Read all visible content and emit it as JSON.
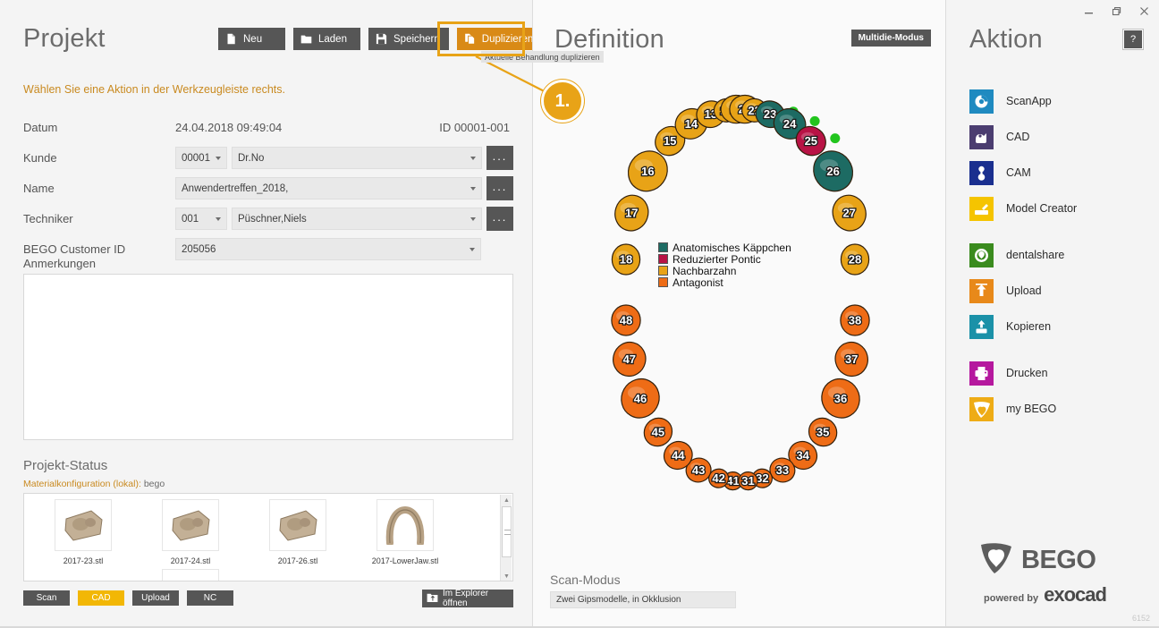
{
  "window": {
    "minimize_label": "minimize",
    "restore_label": "restore",
    "close_label": "close",
    "build_number": "6152"
  },
  "project_panel": {
    "title": "Projekt",
    "toolbar": [
      {
        "label": "Neu",
        "icon": "new-file-icon",
        "accent": false
      },
      {
        "label": "Laden",
        "icon": "folder-icon",
        "accent": false
      },
      {
        "label": "Speichern",
        "icon": "save-icon",
        "accent": false
      },
      {
        "label": "Duplizieren",
        "icon": "copy-icon",
        "accent": true
      }
    ],
    "tooltip": "Aktuelle Behandlung duplizieren",
    "callout_number": "1.",
    "hint": "Wählen Sie eine Aktion in der Werkzeugleiste rechts.",
    "fields": {
      "datum_label": "Datum",
      "datum_value": "24.04.2018  09:49:04",
      "id_value": "ID  00001-001",
      "kunde_label": "Kunde",
      "kunde_number": "00001",
      "kunde_name": "Dr.No",
      "name_label": "Name",
      "name_value": "Anwendertreffen_2018,",
      "techniker_label": "Techniker",
      "techniker_number": "001",
      "techniker_name": "Püschner,Niels",
      "customer_id_label": "BEGO Customer ID",
      "customer_id_value": "205056",
      "dots_label": "...",
      "anmerkungen_label": "Anmerkungen",
      "anmerkungen_value": ""
    },
    "status": {
      "title": "Projekt-Status",
      "material_label": "Materialkonfiguration (lokal):",
      "material_value": "bego",
      "files": [
        {
          "name": "2017-23.stl",
          "kind": "die"
        },
        {
          "name": "2017-24.stl",
          "kind": "die"
        },
        {
          "name": "2017-26.stl",
          "kind": "die"
        },
        {
          "name": "2017-LowerJaw.stl",
          "kind": "jaw"
        }
      ],
      "buttons": [
        {
          "label": "Scan",
          "active": false
        },
        {
          "label": "CAD",
          "active": true
        },
        {
          "label": "Upload",
          "active": false
        },
        {
          "label": "NC",
          "active": false
        }
      ],
      "explorer_button": "Im Explorer öffnen",
      "explorer_icon": "folder-up-icon"
    }
  },
  "definition_panel": {
    "title": "Definition",
    "multidie_button": "Multidie-Modus",
    "legend": [
      {
        "label": "Anatomisches Käppchen",
        "color": "#1d6b63"
      },
      {
        "label": "Reduzierter Pontic",
        "color": "#b81345"
      },
      {
        "label": "Nachbarzahn",
        "color": "#e8a317"
      },
      {
        "label": "Antagonist",
        "color": "#ee6c16"
      }
    ],
    "scan_modus_label": "Scan-Modus",
    "scan_modus_value": "Zwei Gipsmodelle, in Okklusion",
    "tooth_chart": {
      "colors": {
        "anatomic_cap": "#1d6b63",
        "reduced_pontic": "#b81345",
        "neighbor": "#e8a317",
        "antagonist": "#ee6c16",
        "marker": "#22c51e"
      },
      "upper_right": [
        {
          "id": "18",
          "type": "neighbor"
        },
        {
          "id": "17",
          "type": "neighbor"
        },
        {
          "id": "16",
          "type": "neighbor"
        },
        {
          "id": "15",
          "type": "neighbor"
        },
        {
          "id": "14",
          "type": "neighbor"
        },
        {
          "id": "13",
          "type": "neighbor"
        },
        {
          "id": "12",
          "type": "neighbor"
        },
        {
          "id": "11",
          "type": "neighbor"
        }
      ],
      "upper_left": [
        {
          "id": "21",
          "type": "neighbor"
        },
        {
          "id": "22",
          "type": "neighbor"
        },
        {
          "id": "23",
          "type": "anatomic_cap",
          "marker": true
        },
        {
          "id": "24",
          "type": "anatomic_cap",
          "marker": true
        },
        {
          "id": "25",
          "type": "reduced_pontic",
          "marker": true
        },
        {
          "id": "26",
          "type": "anatomic_cap"
        },
        {
          "id": "27",
          "type": "neighbor"
        },
        {
          "id": "28",
          "type": "neighbor"
        }
      ],
      "lower_left": [
        {
          "id": "38",
          "type": "antagonist"
        },
        {
          "id": "37",
          "type": "antagonist"
        },
        {
          "id": "36",
          "type": "antagonist"
        },
        {
          "id": "35",
          "type": "antagonist"
        },
        {
          "id": "34",
          "type": "antagonist"
        },
        {
          "id": "33",
          "type": "antagonist"
        },
        {
          "id": "32",
          "type": "antagonist"
        },
        {
          "id": "31",
          "type": "antagonist"
        }
      ],
      "lower_right": [
        {
          "id": "41",
          "type": "antagonist"
        },
        {
          "id": "42",
          "type": "antagonist"
        },
        {
          "id": "43",
          "type": "antagonist"
        },
        {
          "id": "44",
          "type": "antagonist"
        },
        {
          "id": "45",
          "type": "antagonist"
        },
        {
          "id": "46",
          "type": "antagonist"
        },
        {
          "id": "47",
          "type": "antagonist"
        },
        {
          "id": "48",
          "type": "antagonist"
        }
      ]
    }
  },
  "action_panel": {
    "title": "Aktion",
    "help_button": "?",
    "items": [
      {
        "label": "ScanApp",
        "color": "#1f8ac0",
        "icon": "scanapp-icon",
        "gap": false
      },
      {
        "label": "CAD",
        "color": "#4b3d70",
        "icon": "cad-icon",
        "gap": false
      },
      {
        "label": "CAM",
        "color": "#1a2f8f",
        "icon": "cam-icon",
        "gap": false
      },
      {
        "label": "Model Creator",
        "color": "#f5c400",
        "icon": "model-creator-icon",
        "gap": false
      },
      {
        "label": "dentalshare",
        "color": "#3a8b1e",
        "icon": "dentalshare-icon",
        "gap": true
      },
      {
        "label": "Upload",
        "color": "#e8891a",
        "icon": "upload-icon",
        "gap": false
      },
      {
        "label": "Kopieren",
        "color": "#1b91a8",
        "icon": "copy-action-icon",
        "gap": false
      },
      {
        "label": "Drucken",
        "color": "#b5189e",
        "icon": "print-icon",
        "gap": true
      },
      {
        "label": "my BEGO",
        "color": "#eeac16",
        "icon": "mybego-icon",
        "gap": false
      }
    ],
    "brand": "BEGO",
    "powered_by": "powered by",
    "powered_brand": "exocad"
  }
}
